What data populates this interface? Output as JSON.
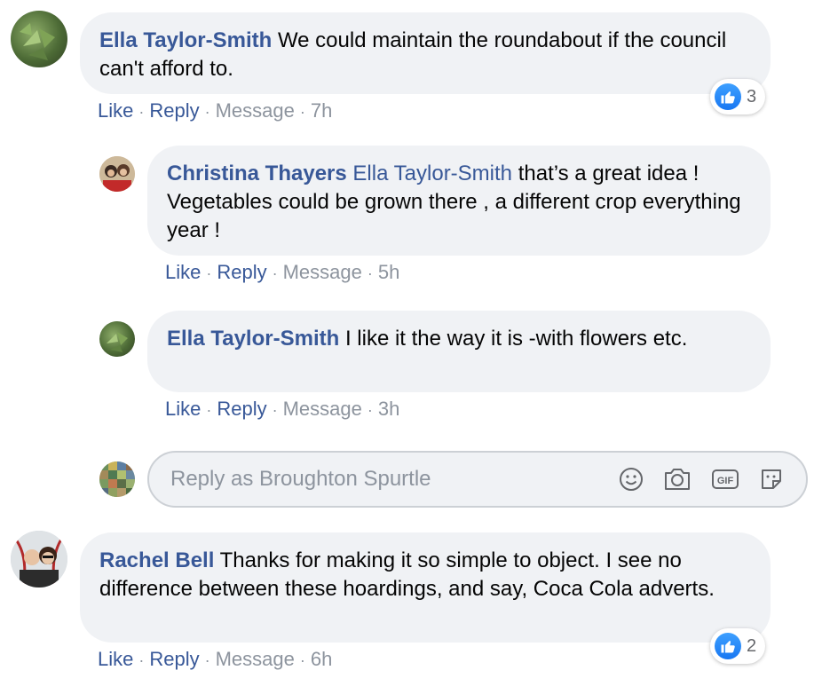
{
  "comments": [
    {
      "author": "Ella Taylor-Smith",
      "text": "We could maintain the roundabout if the council can't afford to.",
      "actions": {
        "like": "Like",
        "reply": "Reply",
        "message": "Message",
        "time": "7h"
      },
      "reactions": "3"
    },
    {
      "author": "Christina Thayers",
      "mention": "Ella Taylor-Smith",
      "text": "that’s a great idea ! Vegetables could be grown there , a different crop everything year !",
      "actions": {
        "like": "Like",
        "reply": "Reply",
        "message": "Message",
        "time": "5h"
      }
    },
    {
      "author": "Ella Taylor-Smith",
      "text": "I like it the way it is -with flowers etc.",
      "actions": {
        "like": "Like",
        "reply": "Reply",
        "message": "Message",
        "time": "3h"
      }
    },
    {
      "author": "Rachel Bell",
      "text": "Thanks for making it so simple to object. I see no difference between these hoardings, and say, Coca Cola adverts.",
      "actions": {
        "like": "Like",
        "reply": "Reply",
        "message": "Message",
        "time": "6h"
      },
      "reactions": "2"
    }
  ],
  "composer": {
    "placeholder": "Reply as Broughton Spurtle",
    "icons": [
      "emoji-icon",
      "camera-icon",
      "gif-icon",
      "sticker-icon"
    ]
  },
  "colors": {
    "name": "#385898",
    "bubble": "#f0f2f5",
    "meta": "#8d949e",
    "like_blue": "#1877f2"
  }
}
